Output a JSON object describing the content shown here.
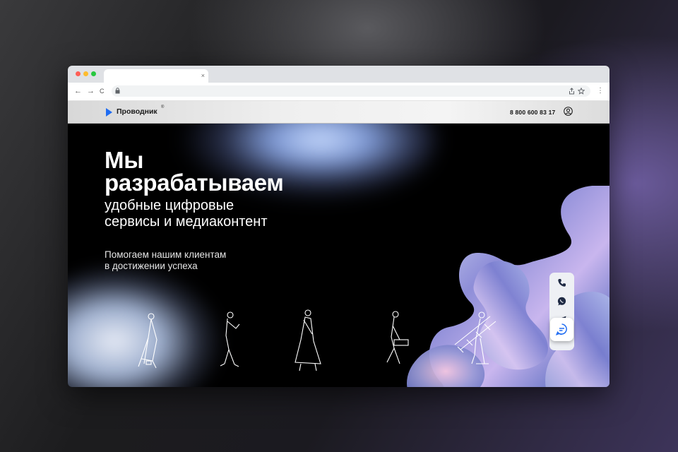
{
  "browser": {
    "tab_close": "×",
    "nav": {
      "back": "←",
      "forward": "→",
      "reload": "C"
    },
    "icons": [
      "lock-icon",
      "share-icon",
      "bookmark-star-icon",
      "menu-dots-icon"
    ]
  },
  "site": {
    "brand": "Проводник",
    "brand_mark": "®",
    "phone": "8 800 600 83 17"
  },
  "hero": {
    "title_line1": "Мы",
    "title_line2": "разрабатываем",
    "subtitle_line1": "удобные цифровые",
    "subtitle_line2": "сервисы и медиаконтент",
    "tagline_line1": "Помогаем нашим клиентам",
    "tagline_line2": "в достижении успеха"
  },
  "contacts": [
    "phone-icon",
    "whatsapp-icon",
    "telegram-icon",
    "chat-icon"
  ],
  "colors": {
    "brand_blue": "#1f6cf2",
    "header_bg": "#eeeeee",
    "hero_bg": "#000000"
  }
}
